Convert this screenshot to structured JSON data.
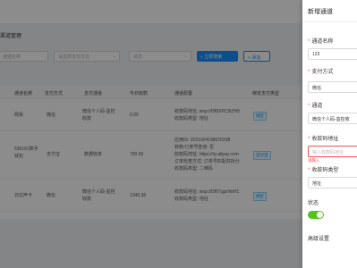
{
  "page": {
    "section_title": "渠道管理",
    "filters": {
      "channel_name_placeholder": "通道名称",
      "pay_type_placeholder": "请选择支付方式",
      "status_placeholder": "状态"
    },
    "buttons": {
      "search": "立即搜索",
      "add": "+ 添加"
    },
    "table": {
      "headers": [
        "通道名称",
        "支付方式",
        "支付通道",
        "今日收款",
        "通道配置",
        "绑定支付类型"
      ],
      "rows": [
        {
          "name": "网易",
          "pay_type": "微信",
          "channel": "微信个人码-监控收款",
          "today": "0.00",
          "config": [
            "收款码地址: wxp://f2f0XPC5tZH5",
            "收款码类型: 地址"
          ],
          "tag": "绑定"
        },
        {
          "name": "630181数字钱包",
          "pay_type": "支付宝",
          "channel": "数据收单",
          "today": "790.00",
          "config": [
            "应用ID: 2021004198676338",
            "转账/订单号查询: 否",
            "收款码地址: https://qr.alipay.com",
            "订单检查方式: 订单号匹配并拆分",
            "收款码类型: 二维码"
          ],
          "tag": "支付宝"
        },
        {
          "name": "日达声卡",
          "pay_type": "微信",
          "channel": "微信个人码-监控收款",
          "today": "1345.38",
          "config": [
            "收款码地址: wxp://f2f07gpr/hkH1",
            "收款码类型: 地址"
          ],
          "tag": "绑定"
        }
      ]
    }
  },
  "drawer": {
    "title": "新增通道",
    "fields": {
      "channel_name": {
        "label": "通道名称",
        "value": "123"
      },
      "pay_type": {
        "label": "支付方式",
        "value": "微信"
      },
      "channel": {
        "label": "通道",
        "value": "微信个人码-监控收"
      },
      "qr_address": {
        "label": "收款码地址",
        "placeholder": "输入收款码地址",
        "error": "请输入"
      },
      "qr_type": {
        "label": "收款码类型",
        "value": "地址"
      },
      "status": {
        "label": "状态",
        "on": true
      },
      "advanced": {
        "label": "高级设置"
      }
    }
  },
  "colors": {
    "primary": "#1890ff",
    "error": "#ff4d4f",
    "switch_on": "#52c41a"
  },
  "icons": {
    "search": "search-icon",
    "chevron": "chevron-down-icon"
  }
}
